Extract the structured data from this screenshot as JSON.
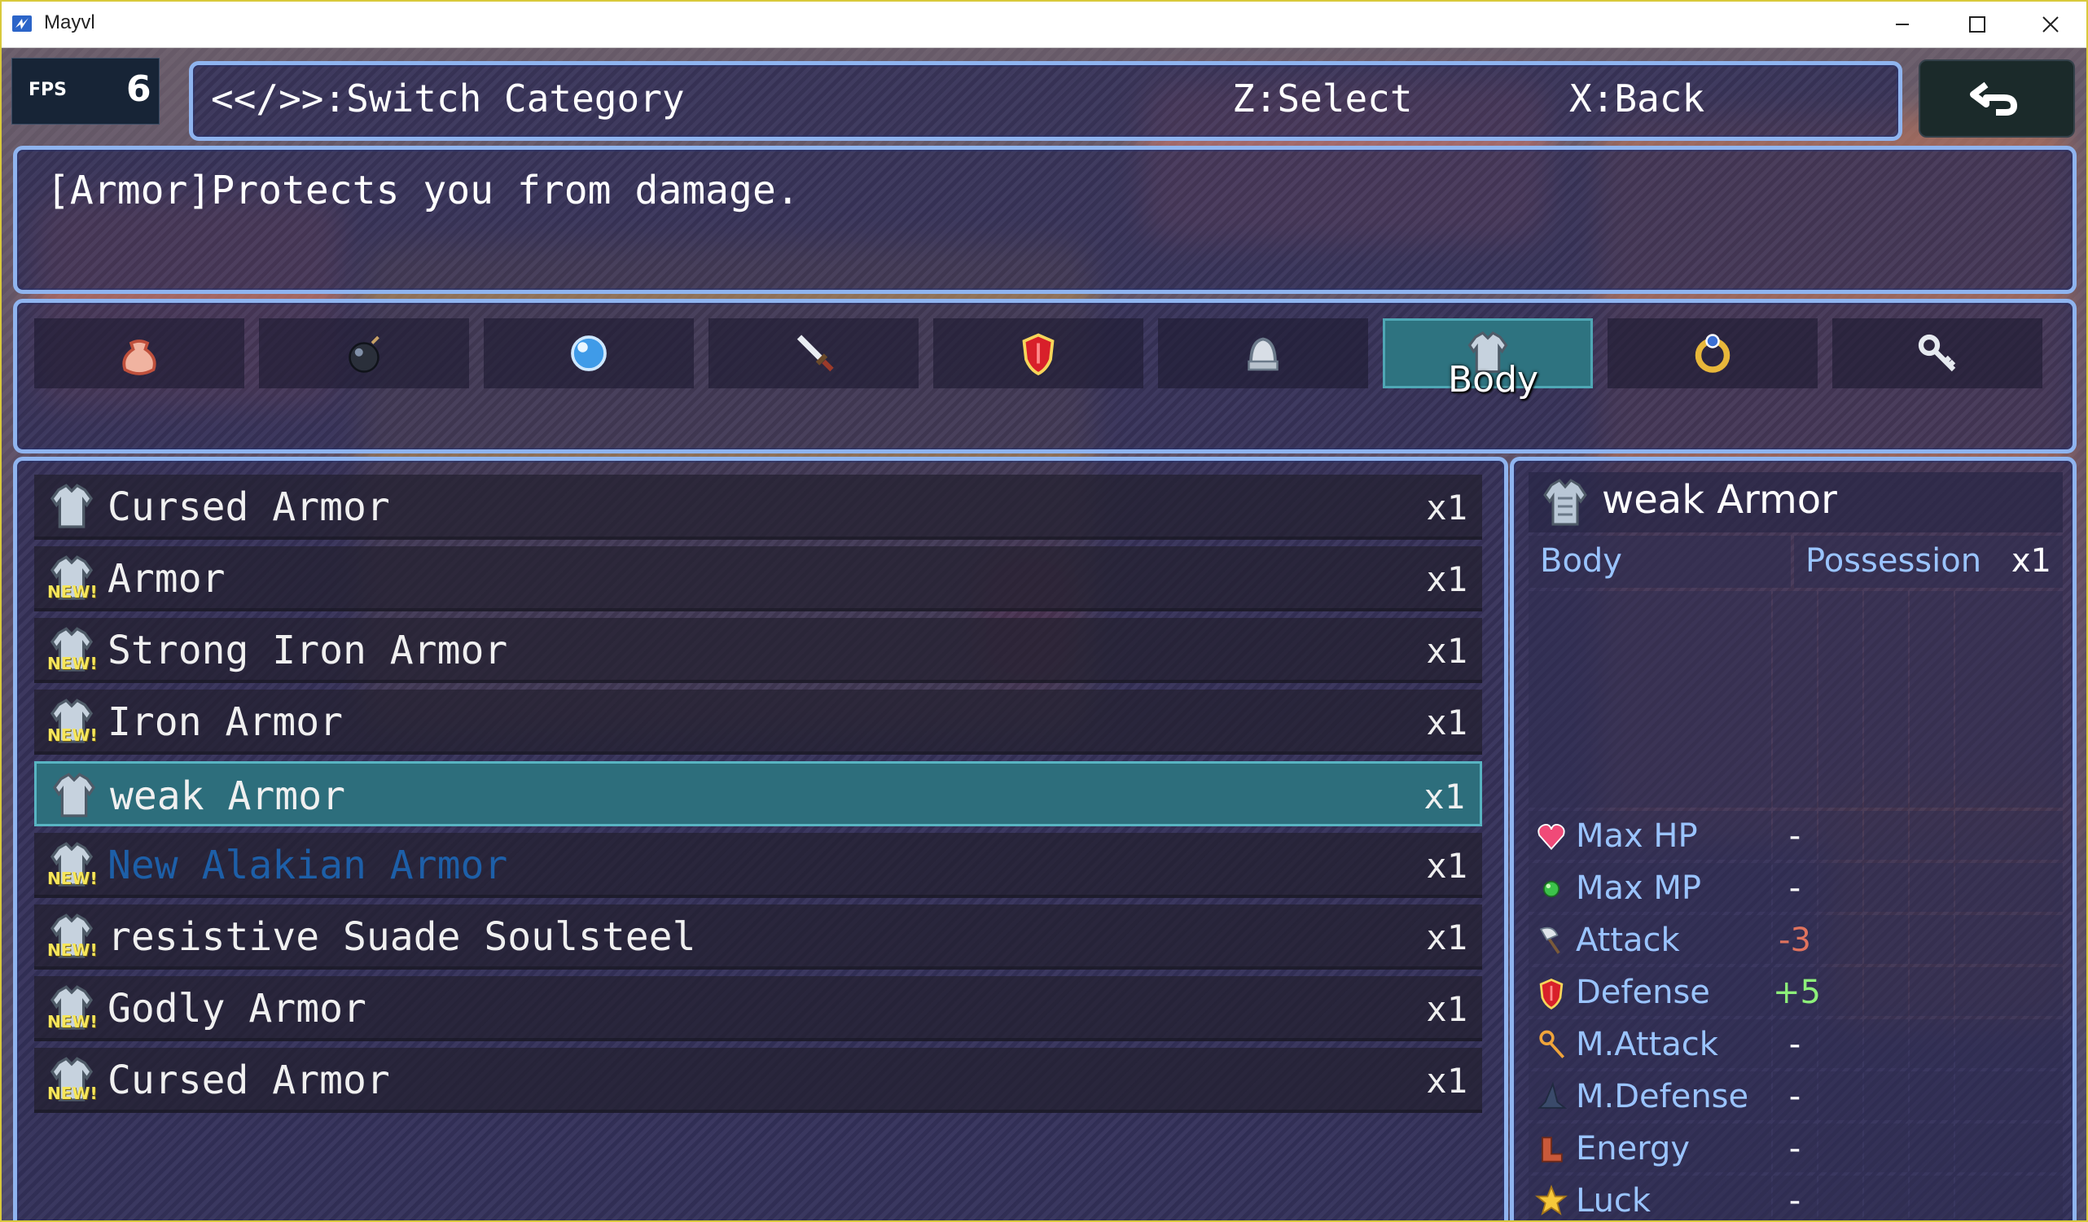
{
  "window": {
    "title": "Mayvl",
    "minimize_glyph": "—",
    "maximize_glyph": "☐",
    "close_glyph": "✕"
  },
  "fps": {
    "label": "FPS",
    "value": "6"
  },
  "hints": {
    "switch": "<</>>:Switch Category",
    "select": "Z:Select",
    "back": "X:Back"
  },
  "help_text": "[Armor]Protects you from damage.",
  "categories": [
    {
      "icon": "pouch-icon",
      "active": false
    },
    {
      "icon": "bomb-icon",
      "active": false
    },
    {
      "icon": "orb-icon",
      "active": false
    },
    {
      "icon": "sword-icon",
      "active": false
    },
    {
      "icon": "shield-icon",
      "active": false
    },
    {
      "icon": "helmet-icon",
      "active": false
    },
    {
      "icon": "body-armor-icon",
      "active": true
    },
    {
      "icon": "ring-icon",
      "active": false
    },
    {
      "icon": "key-icon",
      "active": false
    }
  ],
  "active_category_label": "Body",
  "items": [
    {
      "name": "Cursed Armor",
      "qty": "x1",
      "new": false,
      "selected": false,
      "highlight": false
    },
    {
      "name": "Armor",
      "qty": "x1",
      "new": true,
      "selected": false,
      "highlight": false
    },
    {
      "name": "Strong Iron Armor",
      "qty": "x1",
      "new": true,
      "selected": false,
      "highlight": false
    },
    {
      "name": "Iron Armor",
      "qty": "x1",
      "new": true,
      "selected": false,
      "highlight": false
    },
    {
      "name": "weak Armor",
      "qty": "x1",
      "new": false,
      "selected": true,
      "highlight": false
    },
    {
      "name": "New Alakian Armor",
      "qty": "x1",
      "new": true,
      "selected": false,
      "highlight": true
    },
    {
      "name": "resistive Suade Soulsteel",
      "qty": "x1",
      "new": true,
      "selected": false,
      "highlight": false
    },
    {
      "name": "Godly Armor",
      "qty": "x1",
      "new": true,
      "selected": false,
      "highlight": false
    },
    {
      "name": "Cursed Armor",
      "qty": "x1",
      "new": true,
      "selected": false,
      "highlight": false
    }
  ],
  "new_badge": "NEW!",
  "detail": {
    "name": "weak Armor",
    "slot": "Body",
    "possession_label": "Possession",
    "possession_value": "x1",
    "stats": [
      {
        "name": "Max HP",
        "value": "-",
        "icon": "heart-icon",
        "color": "#ffffff"
      },
      {
        "name": "Max MP",
        "value": "-",
        "icon": "green-gem-icon",
        "color": "#ffffff"
      },
      {
        "name": "Attack",
        "value": "-3",
        "icon": "axe-icon",
        "color": "#e0735e"
      },
      {
        "name": "Defense",
        "value": "+5",
        "icon": "shield-icon",
        "color": "#8df07a"
      },
      {
        "name": "M.Attack",
        "value": "-",
        "icon": "staff-icon",
        "color": "#ffffff"
      },
      {
        "name": "M.Defense",
        "value": "-",
        "icon": "wizard-hat-icon",
        "color": "#ffffff"
      },
      {
        "name": "Energy",
        "value": "-",
        "icon": "boots-icon",
        "color": "#ffffff"
      },
      {
        "name": "Luck",
        "value": "-",
        "icon": "star-icon",
        "color": "#ffffff"
      }
    ]
  }
}
